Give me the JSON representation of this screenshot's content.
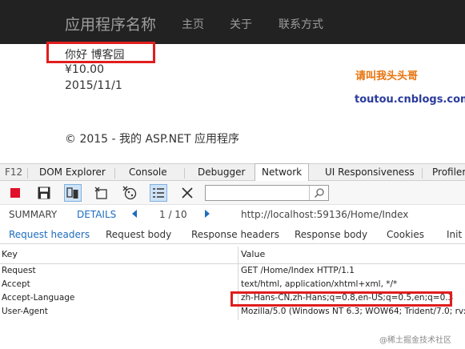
{
  "site": {
    "brand": "应用程序名称",
    "nav": [
      "主页",
      "关于",
      "联系方式"
    ],
    "greeting": "你好 博客园",
    "price": "¥10.00",
    "date": "2015/11/1",
    "footer": "© 2015 - 我的 ASP.NET 应用程序"
  },
  "promo": {
    "title": "请叫我头头哥",
    "url": "toutou.cnblogs.com"
  },
  "devtools": {
    "tabs": [
      "F12",
      "DOM Explorer",
      "Console",
      "Debugger",
      "Network",
      "UI Responsiveness",
      "Profiler"
    ],
    "active_tab": "Network",
    "toolbar_icons": [
      "stop-recording-icon",
      "save-icon",
      "always-refresh-icon",
      "clear-cache-icon",
      "clear-cookies-icon",
      "filter-content-icon",
      "clear-entries-icon",
      "search-icon"
    ],
    "summary": {
      "summary_label": "SUMMARY",
      "details_label": "DETAILS",
      "pager": "1 / 10",
      "url": "http://localhost:59136/Home/Index"
    },
    "subtabs": [
      "Request headers",
      "Request body",
      "Response headers",
      "Response body",
      "Cookies",
      "Init"
    ],
    "active_subtab": "Request headers",
    "table": {
      "columns": [
        "Key",
        "Value"
      ],
      "rows": [
        {
          "key": "Request",
          "value": "GET /Home/Index HTTP/1.1"
        },
        {
          "key": "Accept",
          "value": "text/html, application/xhtml+xml, */*"
        },
        {
          "key": "Accept-Language",
          "value": "zh-Hans-CN,zh-Hans;q=0.8,en-US;q=0.5,en;q=0.3"
        },
        {
          "key": "User-Agent",
          "value": "Mozilla/5.0 (Windows NT 6.3; WOW64; Trident/7.0; rv:11"
        }
      ]
    }
  },
  "watermark": "@稀土掘金技术社区",
  "colors": {
    "navbar_bg": "#222222",
    "nav_text": "#9d9d9d",
    "highlight_red": "#e01d1d",
    "promo_orange": "#e8720c",
    "promo_blue": "#2a3b9a",
    "devtools_blue": "#1e6cbf"
  }
}
